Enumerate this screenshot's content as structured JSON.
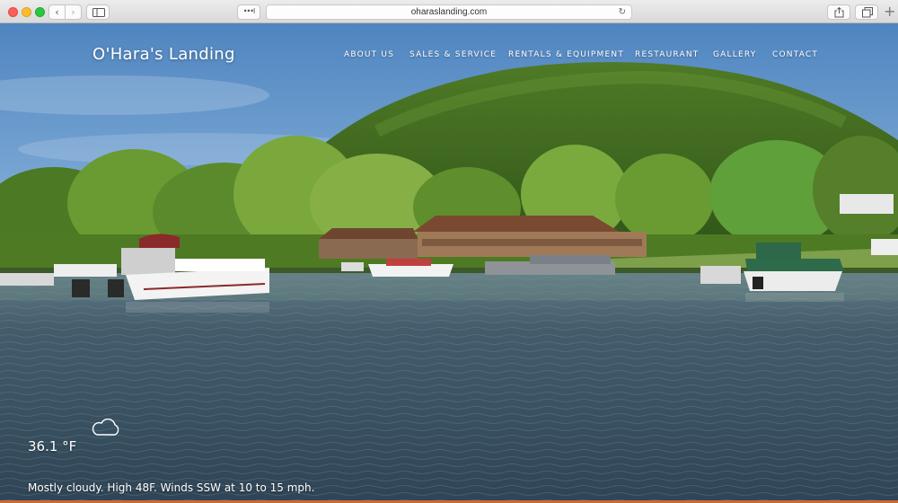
{
  "browser": {
    "url": "oharaslanding.com",
    "ext_label": "•••l"
  },
  "site": {
    "title": "O'Hara's Landing"
  },
  "nav": {
    "items": [
      {
        "label": "ABOUT US"
      },
      {
        "label": "SALES & SERVICE"
      },
      {
        "label": "RENTALS & EQUIPMENT"
      },
      {
        "label": "RESTAURANT"
      },
      {
        "label": "GALLERY"
      },
      {
        "label": "CONTACT"
      }
    ]
  },
  "weather": {
    "icon": "cloud-icon",
    "temperature": "36.1 °F",
    "description": "Mostly cloudy. High 48F. Winds SSW at 10 to 15 mph."
  },
  "colors": {
    "sky": "#5d8fc4",
    "water": "#3d5668",
    "foliage": "#5b8a2c",
    "accent_bar": "#c76a3a"
  }
}
